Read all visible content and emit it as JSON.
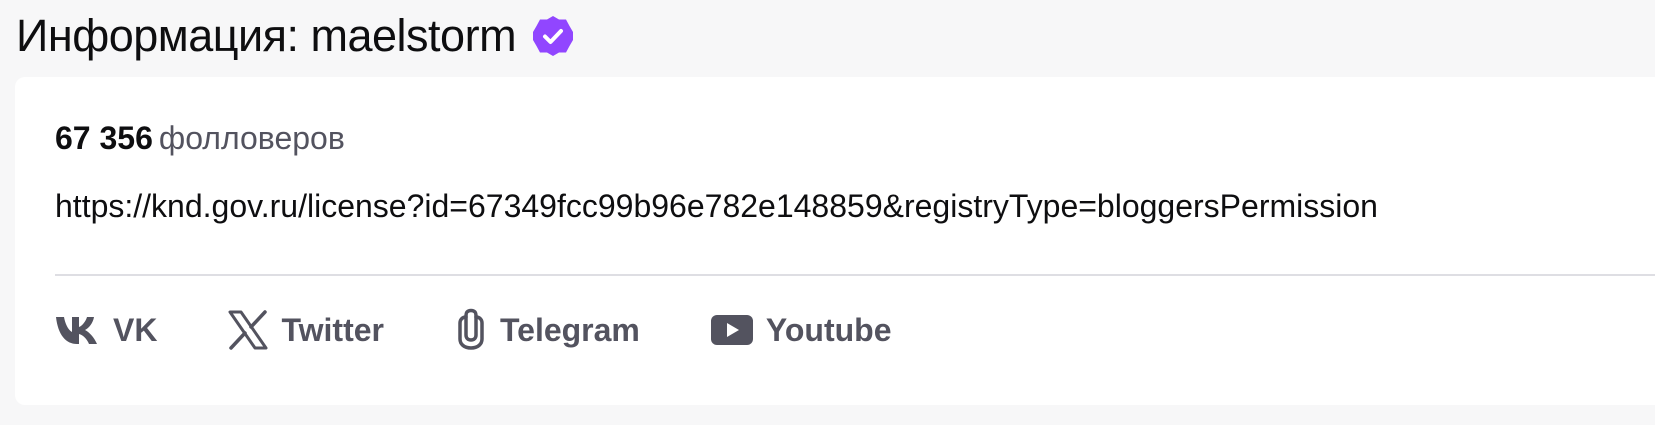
{
  "header": {
    "title": "Информация: maelstorm",
    "verified_icon": "verified-badge-icon",
    "verified_color": "#9146ff"
  },
  "about": {
    "followers_count": "67 356",
    "followers_label": "фолловеров",
    "link": "https://knd.gov.ru/license?id=67349fcc99b96e782e148859&registryType=bloggersPermission"
  },
  "socials": [
    {
      "label": "VK",
      "icon": "vk-icon"
    },
    {
      "label": "Twitter",
      "icon": "x-twitter-icon"
    },
    {
      "label": "Telegram",
      "icon": "link-icon"
    },
    {
      "label": "Youtube",
      "icon": "youtube-icon"
    }
  ],
  "colors": {
    "background": "#f7f7f8",
    "card": "#ffffff",
    "text_primary": "#0e0e10",
    "text_secondary": "#53535f",
    "divider": "#dedee3",
    "accent": "#9146ff"
  }
}
